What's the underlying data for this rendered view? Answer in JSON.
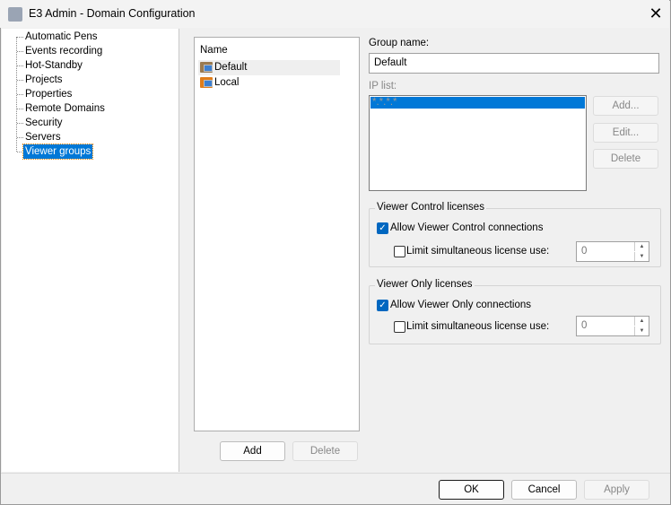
{
  "window": {
    "title": "E3 Admin - Domain Configuration",
    "close_icon": "close-icon",
    "app_icon": "gear-computer-icon"
  },
  "tree": {
    "items": [
      "Automatic Pens",
      "Events recording",
      "Hot-Standby",
      "Projects",
      "Properties",
      "Remote Domains",
      "Security",
      "Servers",
      "Viewer groups"
    ],
    "selected": "Viewer groups"
  },
  "groups": {
    "header": "Name",
    "items": [
      {
        "label": "Default",
        "selected": true
      },
      {
        "label": "Local",
        "selected": false
      }
    ],
    "add_label": "Add",
    "delete_label": "Delete"
  },
  "detail": {
    "group_name_label": "Group name:",
    "group_name_value": "Default",
    "ip_list_label": "IP list:",
    "ip_entries": [
      "*.*.*.*"
    ],
    "ip_add": "Add...",
    "ip_edit": "Edit...",
    "ip_delete": "Delete",
    "viewer_control": {
      "title": "Viewer Control licenses",
      "allow_label": "Allow Viewer Control connections",
      "allow_checked": true,
      "limit_label": "Limit simultaneous license use:",
      "limit_checked": false,
      "limit_value": "0"
    },
    "viewer_only": {
      "title": "Viewer Only licenses",
      "allow_label": "Allow Viewer Only connections",
      "allow_checked": true,
      "limit_label": "Limit simultaneous license use:",
      "limit_checked": false,
      "limit_value": "0"
    }
  },
  "footer": {
    "ok": "OK",
    "cancel": "Cancel",
    "apply": "Apply"
  },
  "colors": {
    "selection": "#0078d7",
    "checkbox": "#0067c0"
  }
}
